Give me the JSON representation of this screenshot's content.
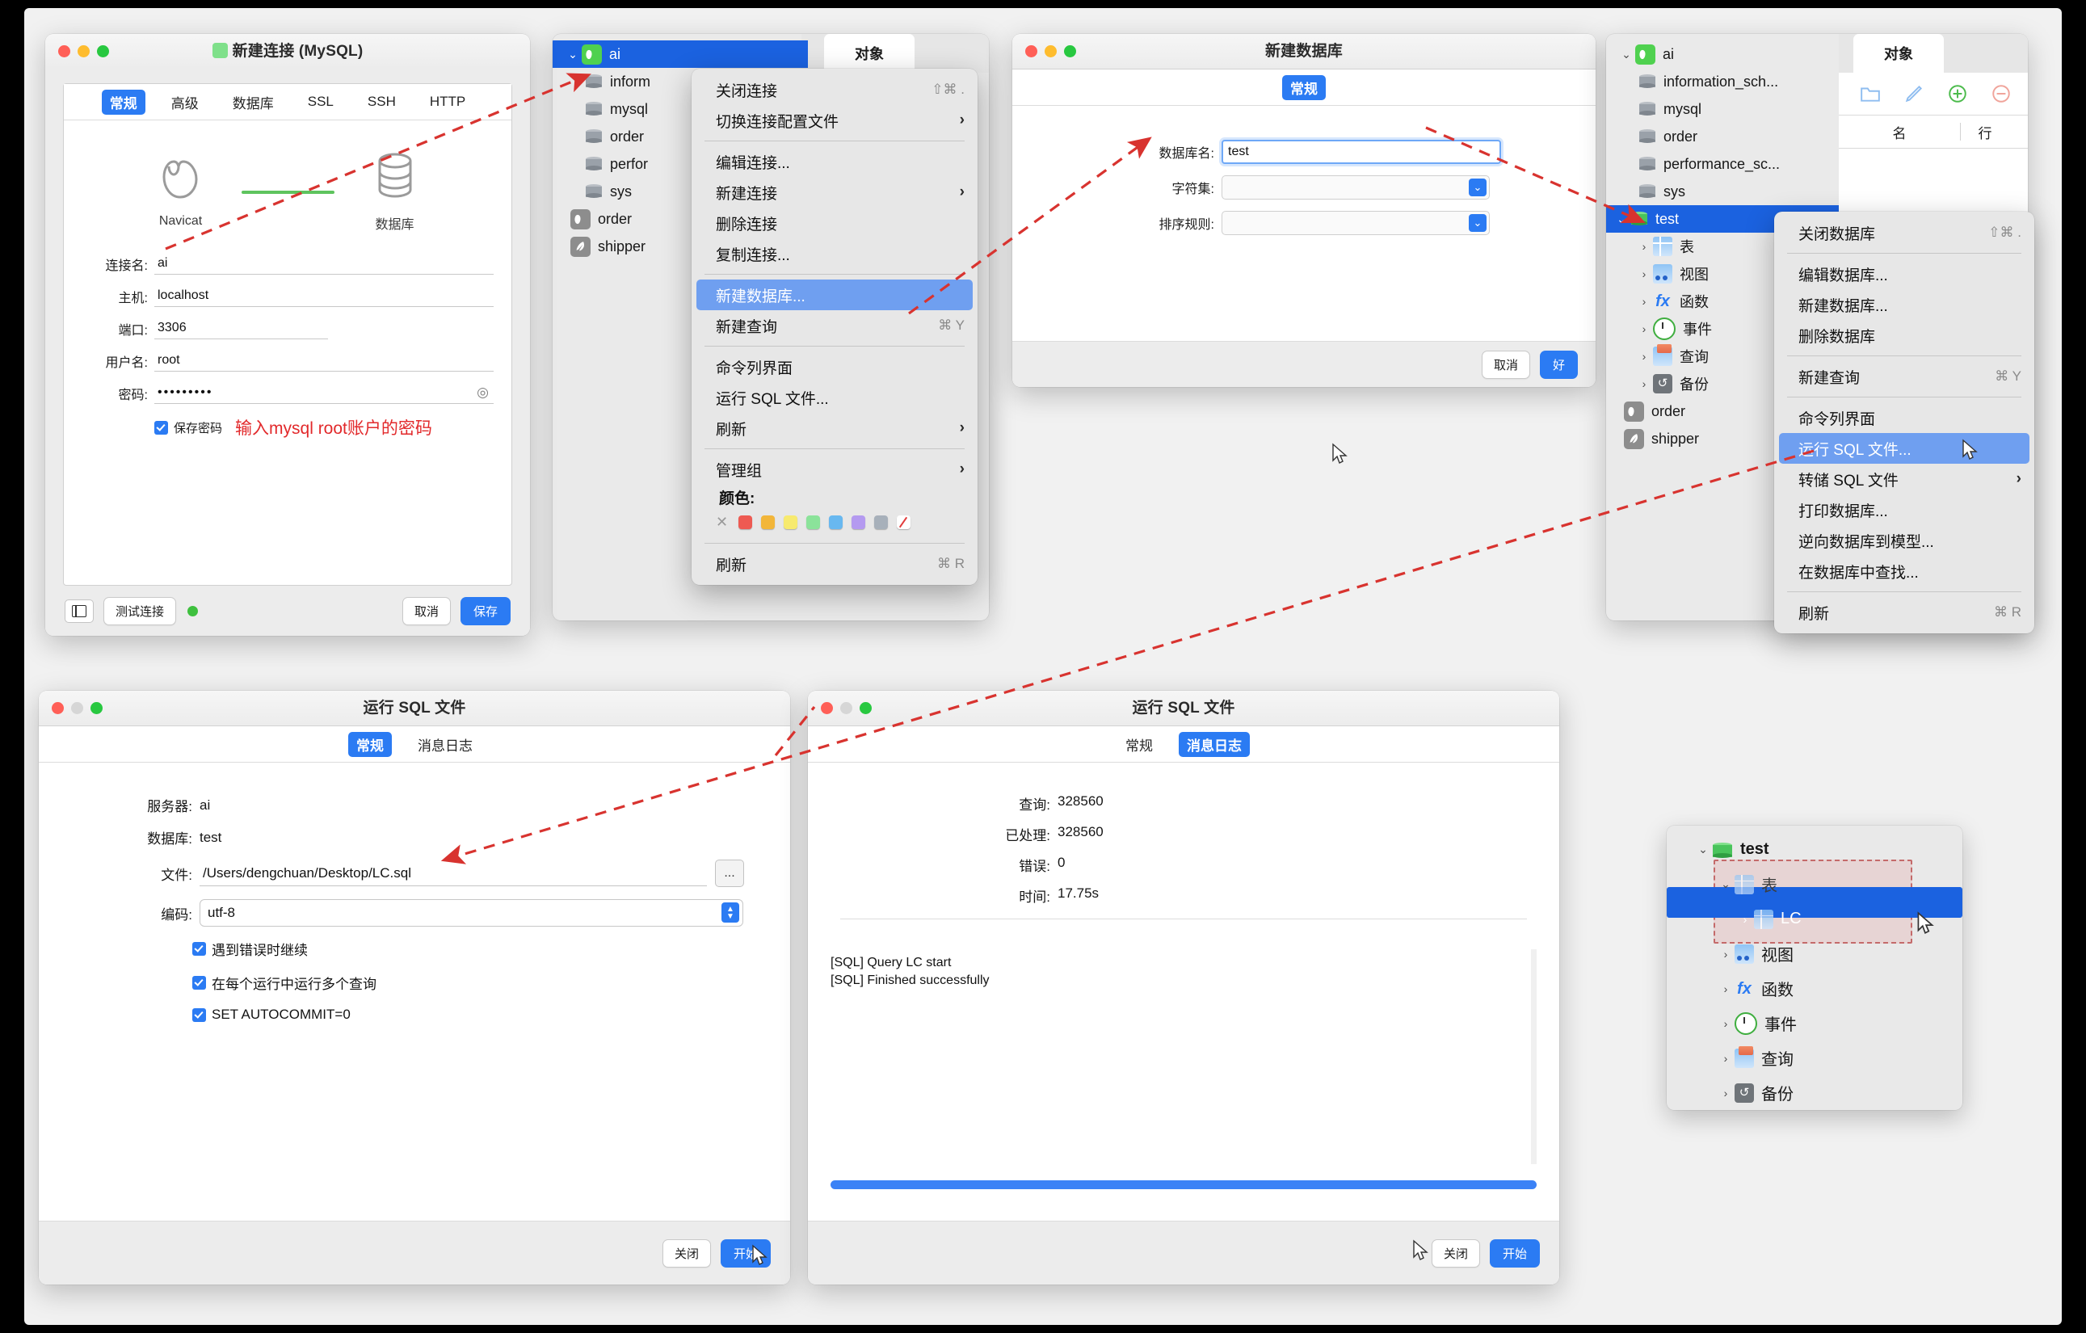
{
  "conn_window": {
    "title": "新建连接 (MySQL)",
    "tabs": [
      "常规",
      "高级",
      "数据库",
      "SSL",
      "SSH",
      "HTTP"
    ],
    "active_tab": "常规",
    "diagram": {
      "left_label": "Navicat",
      "right_label": "数据库"
    },
    "fields": [
      {
        "label": "连接名:",
        "value": "ai"
      },
      {
        "label": "主机:",
        "value": "localhost"
      },
      {
        "label": "端口:",
        "value": "3306"
      },
      {
        "label": "用户名:",
        "value": "root"
      },
      {
        "label": "密码:",
        "value": "•••••••••"
      }
    ],
    "save_password_label": "保存密码",
    "annotation": "输入mysql root账户的密码",
    "annotation_color": "#e2292b",
    "test_button": "测试连接",
    "cancel_button": "取消",
    "save_button": "保存"
  },
  "tree_window": {
    "object_tab": "对象",
    "nodes": [
      {
        "label": "ai",
        "icon": "navicat-icon",
        "selected": true,
        "expanded": true
      },
      {
        "label": "inform",
        "icon": "database-icon"
      },
      {
        "label": "mysql",
        "icon": "database-icon"
      },
      {
        "label": "order",
        "icon": "database-icon"
      },
      {
        "label": "perfor",
        "icon": "database-icon"
      },
      {
        "label": "sys",
        "icon": "database-icon"
      },
      {
        "label": "order",
        "icon": "navicat-gray-icon"
      },
      {
        "label": "shipper",
        "icon": "feather-icon"
      }
    ]
  },
  "conn_context_menu": {
    "items": [
      {
        "label": "关闭连接",
        "shortcut": "⇧⌘ ."
      },
      {
        "label": "切换连接配置文件",
        "submenu": true
      },
      {
        "sep": true
      },
      {
        "label": "编辑连接..."
      },
      {
        "label": "新建连接",
        "submenu": true
      },
      {
        "label": "删除连接"
      },
      {
        "label": "复制连接..."
      },
      {
        "sep": true
      },
      {
        "label": "新建数据库...",
        "highlight": true
      },
      {
        "label": "新建查询",
        "shortcut": "⌘ Y"
      },
      {
        "sep": true
      },
      {
        "label": "命令列界面"
      },
      {
        "label": "运行 SQL 文件..."
      },
      {
        "label": "刷新",
        "submenu": true
      },
      {
        "sep": true
      },
      {
        "label": "管理组",
        "submenu": true
      }
    ],
    "color_label": "颜色:",
    "colors": [
      "#ee5a52",
      "#f2b63a",
      "#f7ea6f",
      "#8be39a",
      "#68b8f0",
      "#b49af0",
      "#a7b0ba"
    ],
    "refresh_label": "刷新",
    "refresh_shortcut": "⌘ R"
  },
  "newdb_window": {
    "title": "新建数据库",
    "tab": "常规",
    "fields": [
      {
        "label": "数据库名:",
        "value": "test",
        "type": "input"
      },
      {
        "label": "字符集:",
        "value": "",
        "type": "select"
      },
      {
        "label": "排序规则:",
        "value": "",
        "type": "select"
      }
    ],
    "cancel_button": "取消",
    "ok_button": "好"
  },
  "right_tree_window": {
    "object_tab": "对象",
    "toolbar_icons": [
      "folder-icon",
      "pencil-icon",
      "plus-circle-icon",
      "minus-circle-icon"
    ],
    "columns": [
      "名",
      "行"
    ],
    "nodes": [
      {
        "label": "ai",
        "icon": "navicat-icon",
        "expanded": true
      },
      {
        "label": "information_sch...",
        "icon": "database-icon"
      },
      {
        "label": "mysql",
        "icon": "database-icon"
      },
      {
        "label": "order",
        "icon": "database-icon"
      },
      {
        "label": "performance_sc...",
        "icon": "database-icon"
      },
      {
        "label": "sys",
        "icon": "database-icon"
      },
      {
        "label": "test",
        "icon": "database-green-icon",
        "selected": true,
        "expanded": true
      },
      {
        "label": "表",
        "icon": "table-icon",
        "child": true
      },
      {
        "label": "视图",
        "icon": "view-icon",
        "child": true
      },
      {
        "label": "函数",
        "icon": "function-icon",
        "child": true
      },
      {
        "label": "事件",
        "icon": "event-icon",
        "child": true
      },
      {
        "label": "查询",
        "icon": "query-icon",
        "child": true
      },
      {
        "label": "备份",
        "icon": "backup-icon",
        "child": true
      },
      {
        "label": "order",
        "icon": "navicat-gray-icon"
      },
      {
        "label": "shipper",
        "icon": "feather-icon"
      }
    ]
  },
  "db_context_menu": {
    "items": [
      {
        "label": "关闭数据库",
        "shortcut": "⇧⌘ ."
      },
      {
        "sep": true
      },
      {
        "label": "编辑数据库..."
      },
      {
        "label": "新建数据库..."
      },
      {
        "label": "删除数据库"
      },
      {
        "sep": true
      },
      {
        "label": "新建查询",
        "shortcut": "⌘ Y"
      },
      {
        "sep": true
      },
      {
        "label": "命令列界面"
      },
      {
        "label": "运行 SQL 文件...",
        "highlight": true
      },
      {
        "label": "转储 SQL 文件",
        "submenu": true
      },
      {
        "label": "打印数据库..."
      },
      {
        "label": "逆向数据库到模型..."
      },
      {
        "label": "在数据库中查找..."
      },
      {
        "sep": true
      },
      {
        "label": "刷新",
        "shortcut": "⌘ R"
      }
    ]
  },
  "runsql_general": {
    "title": "运行 SQL 文件",
    "tabs": [
      "常规",
      "消息日志"
    ],
    "active_tab": "常规",
    "server_label": "服务器:",
    "server_value": "ai",
    "database_label": "数据库:",
    "database_value": "test",
    "file_label": "文件:",
    "file_value": "/Users/dengchuan/Desktop/LC.sql",
    "browse_button": "...",
    "encoding_label": "编码:",
    "encoding_value": "utf-8",
    "checkboxes": [
      {
        "label": "遇到错误时继续",
        "checked": true
      },
      {
        "label": "在每个运行中运行多个查询",
        "checked": true
      },
      {
        "label": "SET AUTOCOMMIT=0",
        "checked": true
      }
    ],
    "close_button": "关闭",
    "start_button": "开始"
  },
  "runsql_log": {
    "title": "运行 SQL 文件",
    "tabs": [
      "常规",
      "消息日志"
    ],
    "active_tab": "消息日志",
    "stats": [
      {
        "label": "查询:",
        "value": "328560"
      },
      {
        "label": "已处理:",
        "value": "328560"
      },
      {
        "label": "错误:",
        "value": "0"
      },
      {
        "label": "时间:",
        "value": "17.75s"
      }
    ],
    "log_lines": [
      "[SQL] Query LC start",
      "[SQL] Finished successfully"
    ],
    "progress_percent": 100,
    "close_button": "关闭",
    "start_button": "开始"
  },
  "tree_popup": {
    "nodes": [
      {
        "label": "test",
        "icon": "database-green-icon",
        "expanded": true
      },
      {
        "label": "表",
        "icon": "table-icon",
        "expanded": true
      },
      {
        "label": "LC",
        "icon": "table-icon",
        "selected": true
      },
      {
        "label": "视图",
        "icon": "view-icon"
      },
      {
        "label": "函数",
        "icon": "function-icon"
      },
      {
        "label": "事件",
        "icon": "event-icon"
      },
      {
        "label": "查询",
        "icon": "query-icon"
      },
      {
        "label": "备份",
        "icon": "backup-icon"
      }
    ]
  },
  "theme": {
    "accent": "#2b7bf3",
    "selection": "#1b62e0",
    "menu_highlight": "#6f9ff0",
    "annotation_red": "#e2292b",
    "progress": "#3b82f6"
  }
}
